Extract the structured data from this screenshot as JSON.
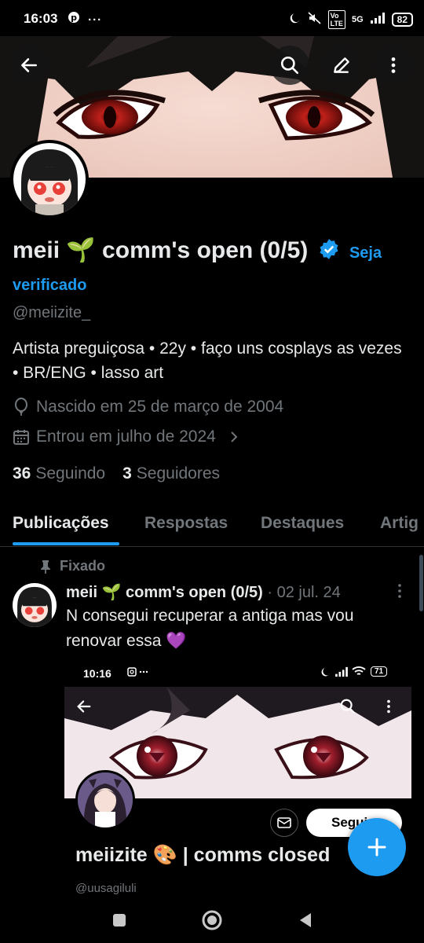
{
  "status_bar": {
    "time": "16:03",
    "battery": "82",
    "network": "5G"
  },
  "header": {
    "back_label": "back",
    "search_label": "search",
    "edit_label": "edit",
    "more_label": "more"
  },
  "profile": {
    "name": "meii 🌱 comm's open (0/5)",
    "verify_cta": "Seja verificado",
    "handle": "@meiizite_",
    "bio": "Artista preguiçosa • 22y • faço uns cosplays as vezes • BR/ENG • lasso art",
    "birth": "Nascido em 25 de março de 2004",
    "joined": "Entrou em julho de 2024",
    "following_count": "36",
    "following_label": "Seguindo",
    "followers_count": "3",
    "followers_label": "Seguidores"
  },
  "tabs": [
    {
      "label": "Publicações",
      "active": true
    },
    {
      "label": "Respostas",
      "active": false
    },
    {
      "label": "Destaques",
      "active": false
    },
    {
      "label": "Artig",
      "active": false
    }
  ],
  "post": {
    "pinned_label": "Fixado",
    "author": "meii 🌱 comm's open (0/5)",
    "date": "· 02 jul. 24",
    "text": "N consegui recuperar a antiga mas vou renovar essa 💜",
    "embed": {
      "time": "10:16",
      "battery": "71",
      "name": "meiizite 🎨 | comms closed",
      "handle": "@uusagiluli",
      "follow_label": "Seguir"
    }
  },
  "colors": {
    "accent": "#1d9bf0",
    "text": "#e7e9ea",
    "muted": "#71767b",
    "background": "#000000"
  }
}
